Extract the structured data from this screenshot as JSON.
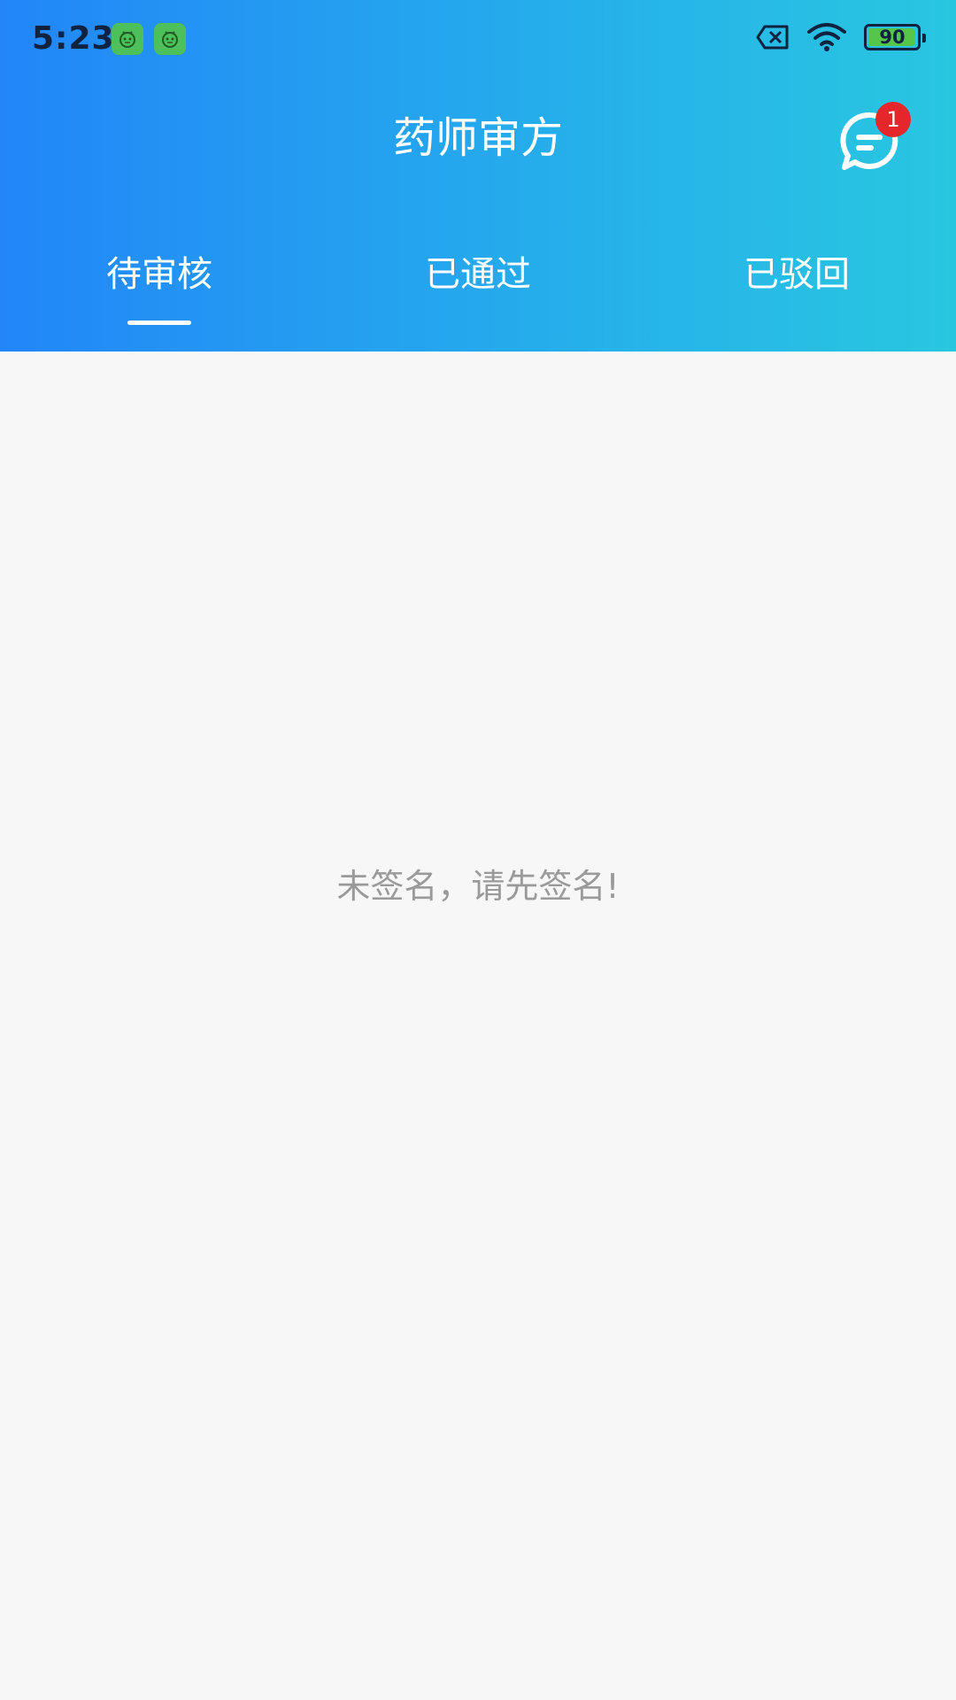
{
  "status_bar": {
    "time": "5:23",
    "battery_level": "90"
  },
  "header": {
    "title": "药师审方",
    "message_badge_count": "1"
  },
  "tabs": [
    {
      "label": "待审核",
      "selected": true
    },
    {
      "label": "已通过",
      "selected": false
    },
    {
      "label": "已驳回",
      "selected": false
    }
  ],
  "empty_state": {
    "message": "未签名，请先签名!"
  },
  "colors": {
    "header_gradient_start": "#2286f8",
    "header_gradient_end": "#29c6e0",
    "badge_red": "#e5262a",
    "background": "#f7f7f8"
  },
  "icons": {
    "app_notification_1": "android-robot-icon",
    "app_notification_2": "android-robot-icon",
    "no_sim": "no-sim-icon",
    "wifi": "wifi-icon",
    "battery": "battery-icon",
    "message": "chat-bubble-icon"
  }
}
